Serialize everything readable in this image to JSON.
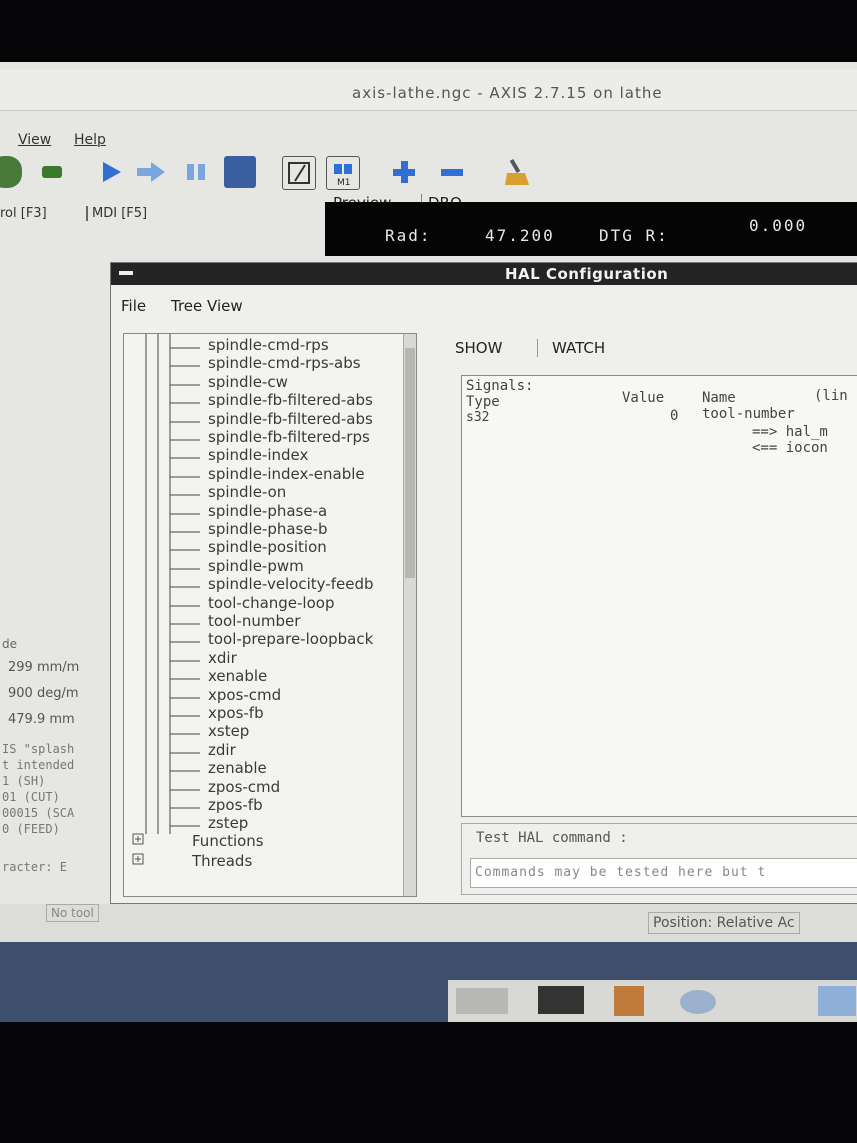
{
  "window": {
    "title": "axis-lathe.ngc - AXIS 2.7.15 on lathe"
  },
  "menu": {
    "view": "View",
    "help": "Help"
  },
  "left_tabs": {
    "manual": "rol [F3]",
    "mdi": "MDI [F5]"
  },
  "right_tabs": {
    "preview": "Preview",
    "dro": "DRO"
  },
  "dro": {
    "rad_label": "Rad:",
    "rad_value": "47.200",
    "dtg_label": "DTG R:",
    "dtg_value": "0.000"
  },
  "left_panel": {
    "de": "de",
    "vel1": "299 mm/m",
    "vel2": "900 deg/m",
    "vel3": "479.9 mm",
    "gcode": [
      "IS \"splash",
      "t intended",
      "1 (SH)",
      "01 (CUT)",
      "00015 (SCA",
      "0 (FEED)"
    ],
    "racter": "racter: E"
  },
  "status": {
    "no_tool": "No tool",
    "position": "Position: Relative Ac"
  },
  "hal": {
    "title": "HAL Configuration",
    "menu_file": "File",
    "menu_tree": "Tree View",
    "tab_show": "SHOW",
    "tab_watch": "WATCH",
    "pins": [
      "spindle-cmd-rps",
      "spindle-cmd-rps-abs",
      "spindle-cw",
      "spindle-fb-filtered-abs",
      "spindle-fb-filtered-abs",
      "spindle-fb-filtered-rps",
      "spindle-index",
      "spindle-index-enable",
      "spindle-on",
      "spindle-phase-a",
      "spindle-phase-b",
      "spindle-position",
      "spindle-pwm",
      "spindle-velocity-feedb",
      "tool-change-loop",
      "tool-number",
      "tool-prepare-loopback",
      "xdir",
      "xenable",
      "xpos-cmd",
      "xpos-fb",
      "xstep",
      "zdir",
      "zenable",
      "zpos-cmd",
      "zpos-fb",
      "zstep"
    ],
    "roots": [
      "Functions",
      "Threads"
    ],
    "output": {
      "signals": "Signals:",
      "type_hdr": "Type",
      "value_hdr": "Value",
      "name_hdr": "Name",
      "lin_hdr": "(lin",
      "type": "s32",
      "value": "0",
      "name": "tool-number",
      "link1": "==> hal_m",
      "link2": "<== iocon"
    },
    "test_label": "Test HAL command :",
    "test_placeholder": "Commands may be tested here but t"
  },
  "colors": {
    "accent_blue": "#2f6fd6",
    "dro_bg": "#050505",
    "hal_title_bg": "#242424"
  }
}
